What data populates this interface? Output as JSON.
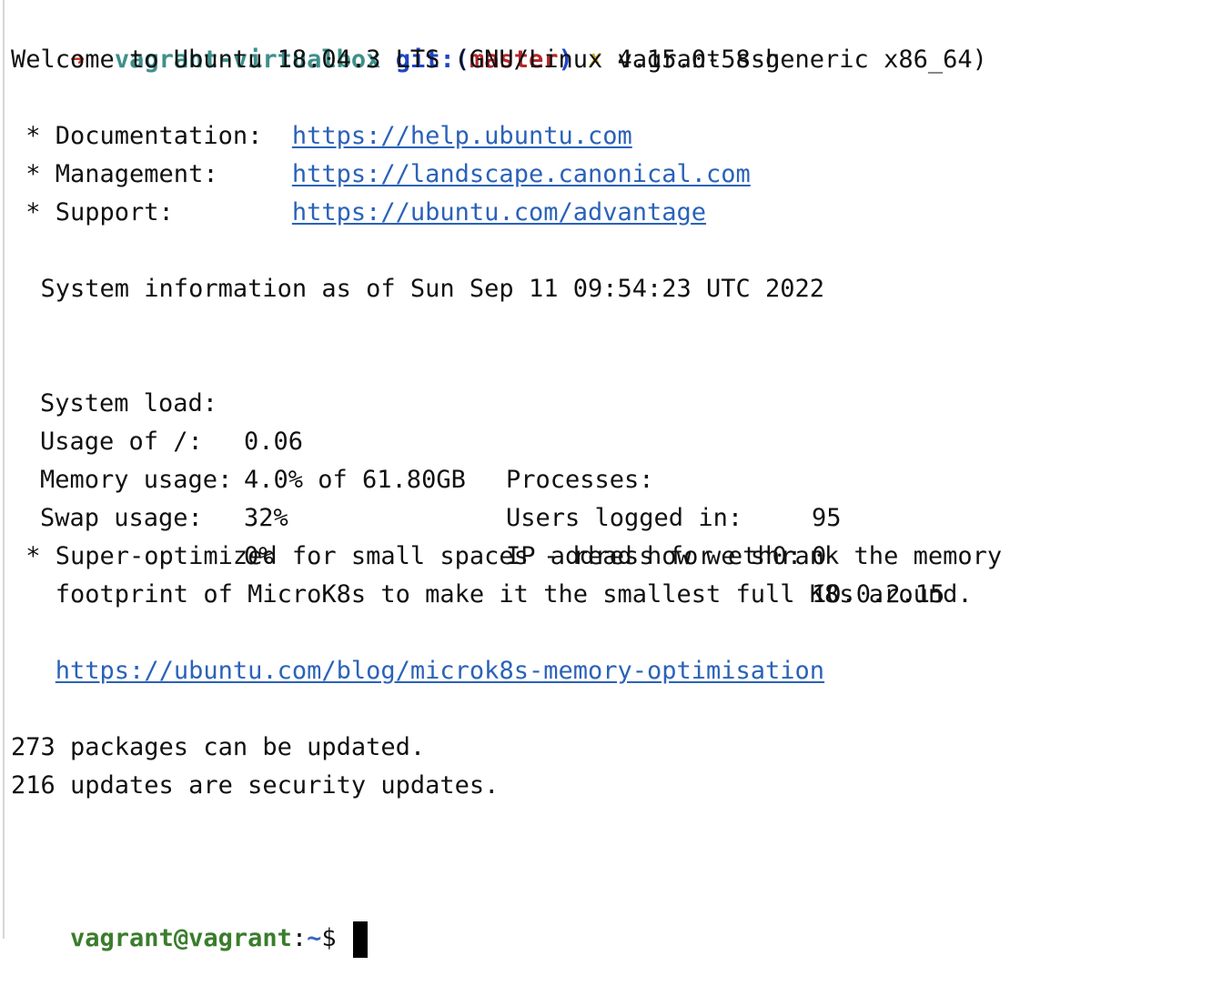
{
  "prompt": {
    "arrow": "➜",
    "directory": "vagrant-virtualbox",
    "git_prefix": "git:(",
    "branch": "master",
    "git_suffix": ")",
    "dirty_mark": "✗",
    "command": "vagrant ssh"
  },
  "welcome": "Welcome to Ubuntu 18.04.3 LTS (GNU/Linux 4.15.0-58-generic x86_64)",
  "links": [
    {
      "label": " * Documentation:  ",
      "url": "https://help.ubuntu.com"
    },
    {
      "label": " * Management:     ",
      "url": "https://landscape.canonical.com"
    },
    {
      "label": " * Support:        ",
      "url": "https://ubuntu.com/advantage"
    }
  ],
  "sysinfo_header": "  System information as of Sun Sep 11 09:54:23 UTC 2022",
  "sysinfo": {
    "system_load_label": "System load:",
    "system_load_value": "0.06",
    "usage_label": "Usage of /:",
    "usage_value": "4.0% of 61.80GB",
    "memory_label": "Memory usage:",
    "memory_value": "32%",
    "swap_label": "Swap usage:",
    "swap_value": "0%",
    "processes_label": "Processes:",
    "processes_value": "95",
    "users_label": "Users logged in:",
    "users_value": "0",
    "ip_label": "IP address for eth0:",
    "ip_value": "10.0.2.15"
  },
  "notice": {
    "line1": " * Super-optimized for small spaces - read how we shrank the memory",
    "line2": "   footprint of MicroK8s to make it the smallest full K8s around.",
    "url": "https://ubuntu.com/blog/microk8s-memory-optimisation"
  },
  "updates": {
    "packages": "273 packages can be updated.",
    "security": "216 updates are security updates."
  },
  "shell_prompt": {
    "user_host": "vagrant@vagrant",
    "colon": ":",
    "path": "~",
    "dollar": "$ "
  }
}
